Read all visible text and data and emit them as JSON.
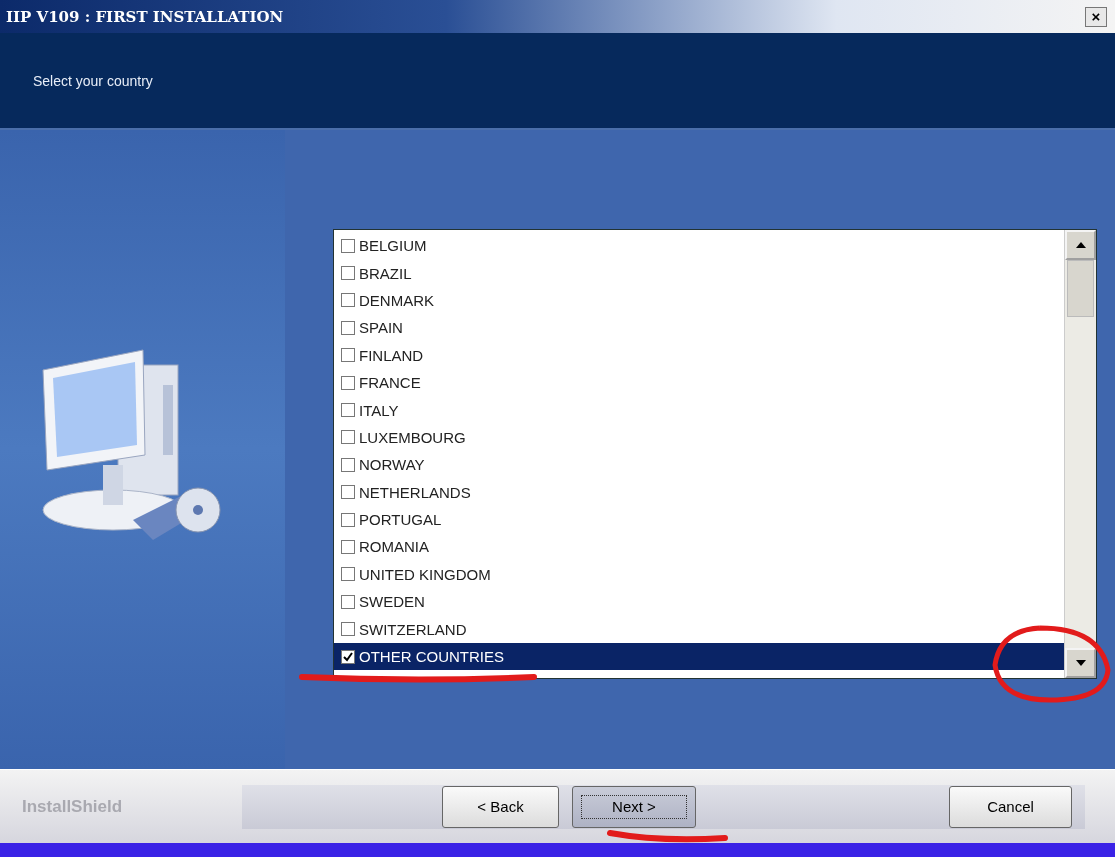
{
  "window": {
    "title": "IIP V109 : FIRST INSTALLATION",
    "close": "×"
  },
  "header": {
    "subtitle": "Select your country"
  },
  "countries": [
    {
      "label": "BELGIUM",
      "checked": false,
      "selected": false
    },
    {
      "label": "BRAZIL",
      "checked": false,
      "selected": false
    },
    {
      "label": "DENMARK",
      "checked": false,
      "selected": false
    },
    {
      "label": "SPAIN",
      "checked": false,
      "selected": false
    },
    {
      "label": "FINLAND",
      "checked": false,
      "selected": false
    },
    {
      "label": "FRANCE",
      "checked": false,
      "selected": false
    },
    {
      "label": "ITALY",
      "checked": false,
      "selected": false
    },
    {
      "label": "LUXEMBOURG",
      "checked": false,
      "selected": false
    },
    {
      "label": "NORWAY",
      "checked": false,
      "selected": false
    },
    {
      "label": "NETHERLANDS",
      "checked": false,
      "selected": false
    },
    {
      "label": "PORTUGAL",
      "checked": false,
      "selected": false
    },
    {
      "label": "ROMANIA",
      "checked": false,
      "selected": false
    },
    {
      "label": "UNITED KINGDOM",
      "checked": false,
      "selected": false
    },
    {
      "label": "SWEDEN",
      "checked": false,
      "selected": false
    },
    {
      "label": "SWITZERLAND",
      "checked": false,
      "selected": false
    },
    {
      "label": "OTHER COUNTRIES",
      "checked": true,
      "selected": true
    }
  ],
  "footer": {
    "brand": "InstallShield",
    "buttons": [
      {
        "label": "< Back",
        "focused": false
      },
      {
        "label": "Next >",
        "focused": true
      },
      {
        "label": "Cancel",
        "focused": false
      }
    ]
  }
}
